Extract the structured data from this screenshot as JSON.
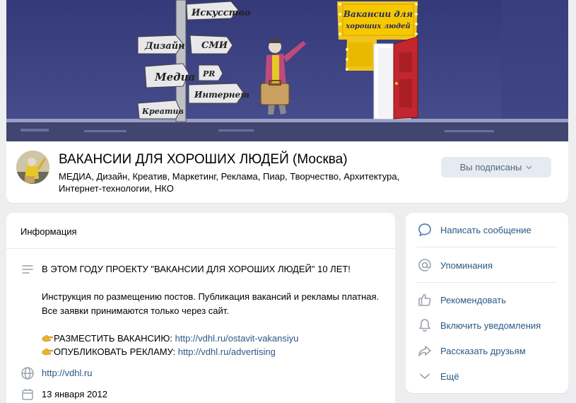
{
  "cover": {
    "signs": [
      "Искусство",
      "Дизайн",
      "СМИ",
      "Медиа",
      "PR",
      "Интернет",
      "Креатив"
    ],
    "billboard_line1": "Вакансии для",
    "billboard_line2": "хороших людей"
  },
  "group": {
    "name": "ВАКАНСИИ ДЛЯ ХОРОШИХ ЛЮДЕЙ (Москва)",
    "status": "МЕДИА, Дизайн, Креатив, Маркетинг, Реклама, Пиар, Творчество, Архитектура, Интернет-технологии, НКО",
    "subscribe_label": "Вы подписаны"
  },
  "info": {
    "title": "Информация",
    "description_line1": "В ЭТОМ ГОДУ ПРОЕКТУ \"ВАКАНСИИ ДЛЯ ХОРОШИХ ЛЮДЕЙ\" 10 ЛЕТ!",
    "description_line2": "Инструкция по размещению постов. Публикация вакансий и рекламы платная. Все заявки принимаются только через сайт.",
    "vacancy_label": "РАЗМЕСТИТЬ ВАКАНСИЮ: ",
    "vacancy_link": "http://vdhl.ru/ostavit-vakansiyu",
    "ad_label": "ОПУБЛИКОВАТЬ РЕКЛАМУ: ",
    "ad_link": "http://vdhl.ru/advertising",
    "website": "http://vdhl.ru",
    "founded": "13 января 2012"
  },
  "actions": [
    {
      "label": "Написать сообщение",
      "icon": "message-icon"
    },
    {
      "label": "Упоминания",
      "icon": "at-icon"
    },
    {
      "label": "Рекомендовать",
      "icon": "thumb-up-icon"
    },
    {
      "label": "Включить уведомления",
      "icon": "bell-icon"
    },
    {
      "label": "Рассказать друзьям",
      "icon": "share-icon"
    },
    {
      "label": "Ещё",
      "icon": "chevron-down-icon"
    }
  ],
  "colors": {
    "link": "#2a5885",
    "icon": "#99a2ad",
    "accent_icon": "#5181b8",
    "button_bg": "#e5ebf1",
    "page_bg": "#edeef0"
  }
}
